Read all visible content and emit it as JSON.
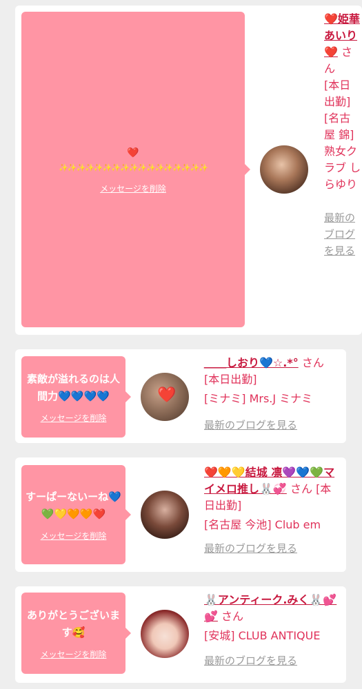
{
  "messages": [
    {
      "text_line1": "❤️",
      "text_line2": "✨✨✨✨✨✨✨✨✨✨✨✨✨✨✨✨✨",
      "delete_label": "メッセージを削除",
      "cast_name": "❤️姫華あいり❤️",
      "honorific": "さん",
      "status": "[本日出勤]",
      "shop": "[名古屋 錦] 熟女クラブ しらゆり",
      "blog_label": "最新のブログを見る"
    },
    {
      "text": "素敵が溢れるのは人間力💙💙💙💙",
      "delete_label": "メッセージを削除",
      "cast_name": "＿＿しおり💙☆.*°",
      "honorific": "さん",
      "status": "[本日出勤]",
      "shop": "[ミナミ] Mrs.J ミナミ",
      "blog_label": "最新のブログを見る"
    },
    {
      "text": "すーぱーないーね💙💚💛🧡🧡❤️",
      "delete_label": "メッセージを削除",
      "cast_name": "❤️🧡💛結城 凛💜💙💚マイメロ推し🐰💞",
      "honorific": "さん",
      "status": "[本日出勤]",
      "shop": "[名古屋 今池] Club em",
      "blog_label": "最新のブログを見る"
    },
    {
      "text": "ありがとうございます🥰",
      "delete_label": "メッセージを削除",
      "cast_name": "🐰アンティーク.みく🐰💕💕",
      "honorific": "さん",
      "shop": "[安城] CLUB ANTIQUE",
      "blog_label": "最新のブログを見る"
    }
  ],
  "colors": {
    "bubble": "#ff95a4",
    "name": "#c8193f",
    "text": "#e0325a",
    "blog_link": "#9a9a9a",
    "background": "#eeeeee"
  }
}
